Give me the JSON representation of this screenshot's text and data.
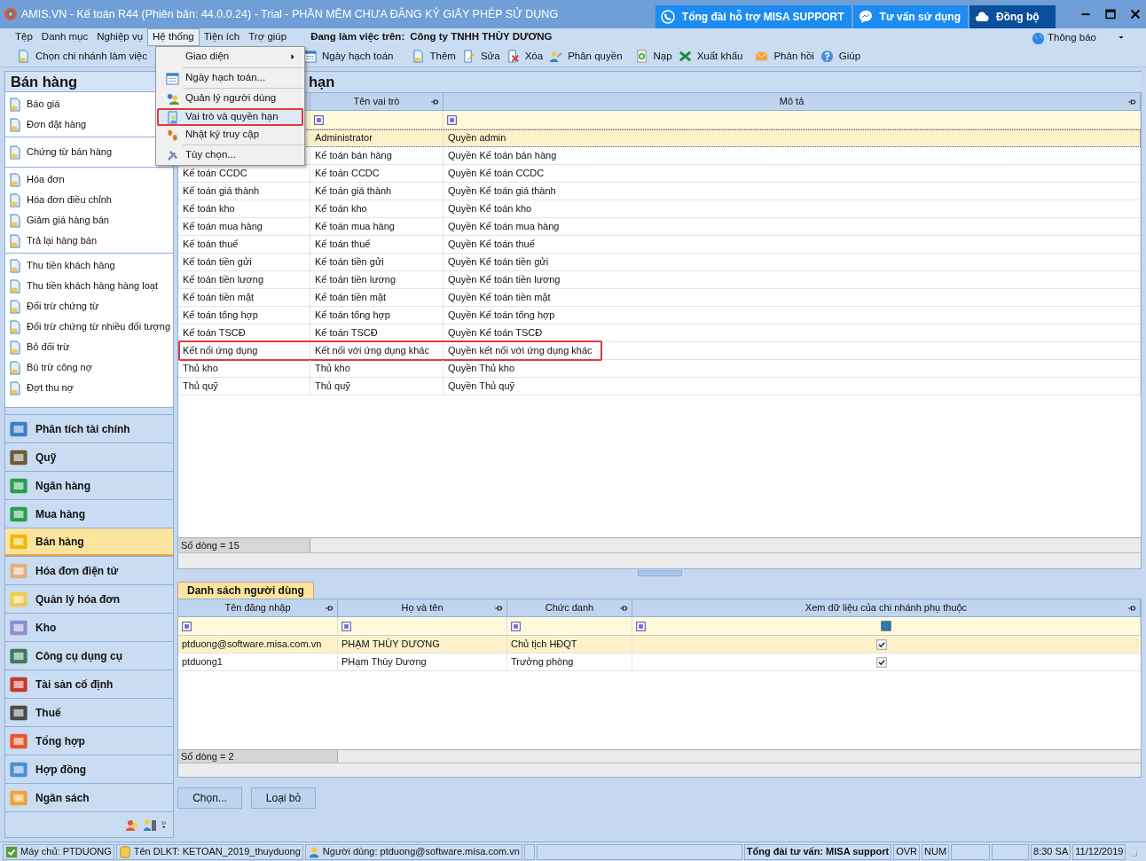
{
  "window": {
    "title": "AMIS.VN - Kế toán R44 (Phiên bản: 44.0.0.24) - Trial - PHẦN MỀM CHƯA ĐĂNG KÝ GIẤY PHÉP SỬ DỤNG"
  },
  "header_buttons": [
    {
      "label": "Tổng đài hỗ trợ MISA SUPPORT",
      "kind": "phone"
    },
    {
      "label": "Tư vấn sử dụng",
      "kind": "chat"
    },
    {
      "label": "Đồng bộ",
      "kind": "sync"
    }
  ],
  "menu_bar": {
    "items": [
      {
        "label": "Tệp",
        "selected": false
      },
      {
        "label": "Danh mục",
        "selected": false
      },
      {
        "label": "Nghiệp vụ",
        "selected": false
      },
      {
        "label": "Hệ thống",
        "selected": true
      },
      {
        "label": "Tiện ích",
        "selected": false
      },
      {
        "label": "Trợ giúp",
        "selected": false
      }
    ],
    "company_label": "Đang làm việc trên:",
    "company": "Công ty TNHH THÙY DƯƠNG",
    "notification": "Thông báo"
  },
  "toolbar": [
    {
      "label": "Chọn chi nhánh làm việc",
      "kind": "doc"
    },
    {
      "label": "Ngày hạch toán",
      "kind": "calendar"
    },
    {
      "label": "Thêm",
      "kind": "add"
    },
    {
      "label": "Sửa",
      "kind": "edit"
    },
    {
      "label": "Xóa",
      "kind": "delete"
    },
    {
      "label": "Phân quyền",
      "kind": "perm"
    },
    {
      "label": "Nạp",
      "kind": "reload"
    },
    {
      "label": "Xuất khẩu",
      "kind": "excel"
    },
    {
      "label": "Phản hồi",
      "kind": "mail"
    },
    {
      "label": "Giúp",
      "kind": "help"
    }
  ],
  "dropdown": [
    {
      "label": "Giao diện",
      "submenu": true,
      "highlighted": false
    },
    {
      "label": "Ngày hạch toán...",
      "submenu": false,
      "highlighted": false
    },
    {
      "label": "Quản lý người dùng",
      "submenu": false,
      "highlighted": false
    },
    {
      "label": "Vai trò và quyền hạn",
      "submenu": false,
      "highlighted": true
    },
    {
      "label": "Nhật ký truy cập",
      "submenu": false,
      "highlighted": false
    },
    {
      "label": "Tùy chọn...",
      "submenu": false,
      "highlighted": false
    }
  ],
  "sidebar": {
    "title": "Bán hàng",
    "groups": [
      [
        "Báo giá",
        "Đơn đặt hàng"
      ],
      [
        "Chứng từ bán hàng"
      ],
      [
        "Hóa đơn",
        "Hóa đơn điều chỉnh",
        "Giảm giá hàng bán",
        "Trả lại hàng bán"
      ],
      [
        "Thu tiền khách hàng",
        "Thu tiền khách hàng hàng loạt",
        "Đối trừ chứng từ",
        "Đối trừ chứng từ nhiều đối tượng",
        "Bỏ đối trừ",
        "Bù trừ công nợ",
        "Đợt thu nợ"
      ]
    ]
  },
  "modules": [
    {
      "label": "Phân tích tài chính",
      "selected": false
    },
    {
      "label": "Quỹ",
      "selected": false
    },
    {
      "label": "Ngân hàng",
      "selected": false
    },
    {
      "label": "Mua hàng",
      "selected": false
    },
    {
      "label": "Bán hàng",
      "selected": true
    },
    {
      "label": "Hóa đơn điện tử",
      "selected": false
    },
    {
      "label": "Quản lý hóa đơn",
      "selected": false
    },
    {
      "label": "Kho",
      "selected": false
    },
    {
      "label": "Công cụ dụng cụ",
      "selected": false
    },
    {
      "label": "Tài sản cố định",
      "selected": false
    },
    {
      "label": "Thuế",
      "selected": false
    },
    {
      "label": "Tổng hợp",
      "selected": false
    },
    {
      "label": "Hợp đồng",
      "selected": false
    },
    {
      "label": "Ngân sách",
      "selected": false
    }
  ],
  "roles_panel": {
    "title": "hạn",
    "columns": [
      "Tên vai trò",
      "Mô tả"
    ],
    "rows": [
      {
        "name": "Administrator",
        "description": "Quyền admin",
        "selected": true,
        "highlighted": false
      },
      {
        "name": "Kế toán bán hàng",
        "description": "Quyền Kế toán bán hàng",
        "selected": false,
        "highlighted": false
      },
      {
        "code": "Kế toán CCDC",
        "name": "Kế toán CCDC",
        "description": "Quyền Kế toán CCDC",
        "selected": false,
        "highlighted": false
      },
      {
        "code": "Kế toán giá thành",
        "name": "Kế toán giá thành",
        "description": "Quyền Kế toán giá thành",
        "selected": false,
        "highlighted": false
      },
      {
        "code": "Kế toán kho",
        "name": "Kế toán kho",
        "description": "Quyền Kế toán kho",
        "selected": false,
        "highlighted": false
      },
      {
        "code": "Kế toán mua hàng",
        "name": "Kế toán mua hàng",
        "description": "Quyền Kế toán mua hàng",
        "selected": false,
        "highlighted": false
      },
      {
        "code": "Kế toán thuế",
        "name": "Kế toán thuế",
        "description": "Quyền Kế toán thuế",
        "selected": false,
        "highlighted": false
      },
      {
        "code": "Kế toán tiền gửi",
        "name": "Kế toán tiền gửi",
        "description": "Quyền Kế toán tiền gửi",
        "selected": false,
        "highlighted": false
      },
      {
        "code": "Kế toán tiền lương",
        "name": "Kế toán tiền lương",
        "description": "Quyền Kế toán tiền lương",
        "selected": false,
        "highlighted": false
      },
      {
        "code": "Kế toán tiền mặt",
        "name": "Kế toán tiền mặt",
        "description": "Quyền Kế toán tiền mặt",
        "selected": false,
        "highlighted": false
      },
      {
        "code": "Kế toán tổng hợp",
        "name": "Kế toán tổng hợp",
        "description": "Quyền Kế toán tổng hợp",
        "selected": false,
        "highlighted": false
      },
      {
        "code": "Kế toán TSCĐ",
        "name": "Kế toán TSCĐ",
        "description": "Quyền Kế toán TSCĐ",
        "selected": false,
        "highlighted": false
      },
      {
        "code": "Kết nối ứng dụng",
        "name": "Kết nối với ứng dụng khác",
        "description": "Quyền kết nối với ứng dụng khác",
        "selected": false,
        "highlighted": true
      },
      {
        "code": "Thủ kho",
        "name": "Thủ kho",
        "description": "Quyền Thủ kho",
        "selected": false,
        "highlighted": false
      },
      {
        "code": "Thủ quỹ",
        "name": "Thủ quỹ",
        "description": "Quyền Thủ quỹ",
        "selected": false,
        "highlighted": false
      }
    ],
    "footer": "Số dòng = 15"
  },
  "users_panel": {
    "tab": "Danh sách người dùng",
    "columns": [
      "Tên đăng nhập",
      "Họ và tên",
      "Chức danh",
      "Xem dữ liệu của chi nhánh phụ thuộc"
    ],
    "rows": [
      {
        "username": "ptduong@software.misa.com.vn",
        "full_name": "PHẠM THÙY DƯƠNG",
        "title": "Chủ tịch HĐQT",
        "view_branch": true,
        "selected": true
      },
      {
        "username": "ptduong1",
        "full_name": "PHạm Thùy Dương",
        "title": "Trưởng phòng",
        "view_branch": true,
        "selected": false
      }
    ],
    "footer": "Số dòng = 2"
  },
  "buttons": [
    "Chọn...",
    "Loại bỏ"
  ],
  "status_bar": [
    {
      "text": "Máy chủ: PTDUONG",
      "kind": "server"
    },
    {
      "text": "Tên DLKT: KETOAN_2019_thuyduong",
      "kind": "database"
    },
    {
      "text": "Người dùng: ptduong@software.misa.com.vn",
      "kind": "user"
    },
    {
      "text": "Tổng đài tư vấn: MISA support",
      "kind": "bold"
    },
    {
      "text": "OVR",
      "kind": "plain"
    },
    {
      "text": "NUM",
      "kind": "plain"
    },
    {
      "text": "8:30 SA",
      "kind": "plain"
    },
    {
      "text": "11/12/2019",
      "kind": "plain"
    }
  ]
}
